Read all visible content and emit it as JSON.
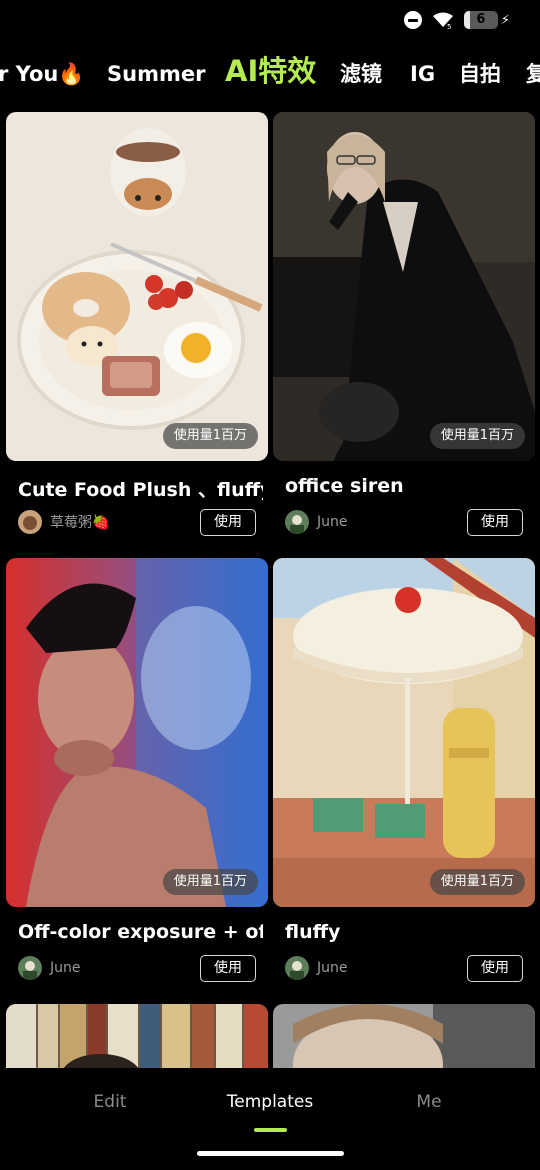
{
  "status_bar": {
    "battery_level": "6"
  },
  "tabs": [
    {
      "label": "r You🔥",
      "active": false
    },
    {
      "label": "Summer",
      "active": false
    },
    {
      "label": "AI特效",
      "active": true
    },
    {
      "label": "滤镜",
      "active": false
    },
    {
      "label": "IG",
      "active": false
    },
    {
      "label": "自拍",
      "active": false
    },
    {
      "label": "复",
      "active": false
    }
  ],
  "cards": [
    {
      "title": "Cute Food Plush 、fluffy",
      "usage": "使用量1百万",
      "author": "草莓粥🍓",
      "use_label": "使用"
    },
    {
      "title": "office siren",
      "usage": "使用量1百万",
      "author": "June",
      "use_label": "使用"
    },
    {
      "title": "Off-color exposure + off...",
      "usage": "使用量1百万",
      "author": "June",
      "use_label": "使用"
    },
    {
      "title": "fluffy",
      "usage": "使用量1百万",
      "author": "June",
      "use_label": "使用"
    }
  ],
  "bottom_nav": {
    "items": [
      {
        "label": "Edit",
        "active": false
      },
      {
        "label": "Templates",
        "active": true
      },
      {
        "label": "Me",
        "active": false
      }
    ]
  },
  "colors": {
    "accent": "#b4eb4f",
    "background": "#000000"
  }
}
